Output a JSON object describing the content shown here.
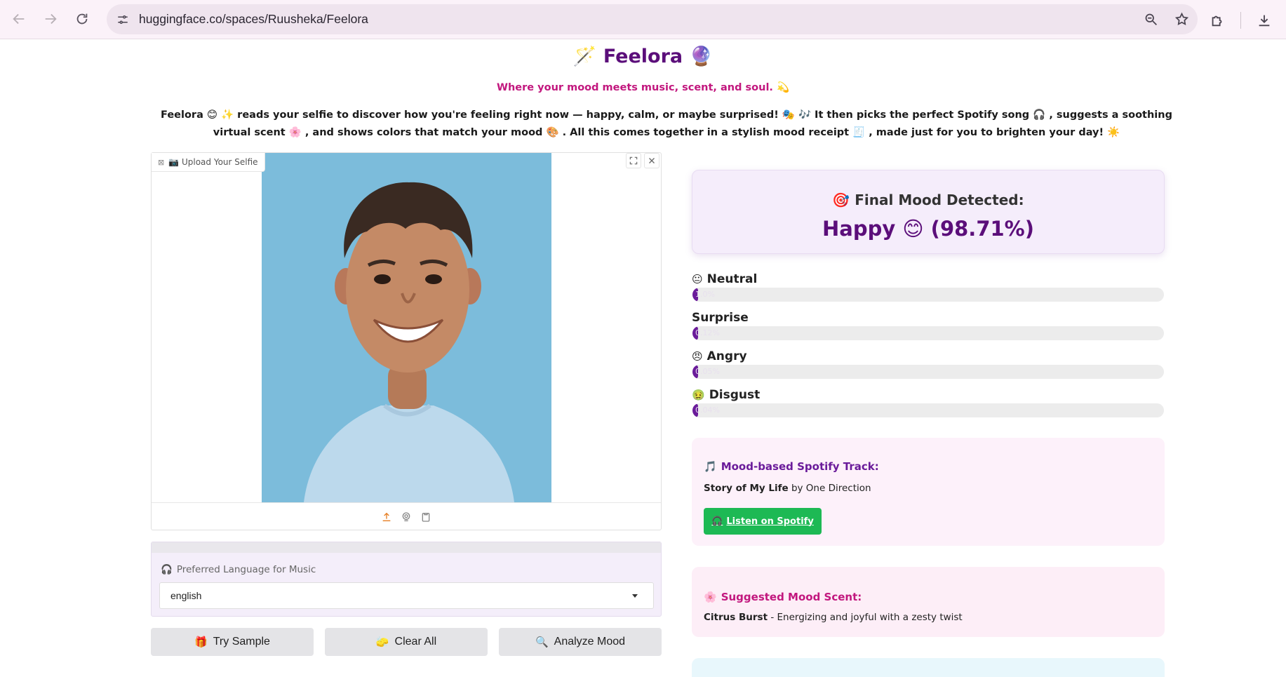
{
  "browser": {
    "url": "huggingface.co/spaces/Ruusheka/Feelora"
  },
  "header": {
    "title": "🪄 Feelora 🔮",
    "tagline": "Where your mood meets music, scent, and soul. 💫",
    "description": "Feelora 😊 ✨ reads your selfie to discover how you're feeling right now — happy, calm, or maybe surprised! 🎭 🎶 It then picks the perfect Spotify song 🎧 , suggests a soothing virtual scent 🌸 , and shows colors that match your mood 🎨 . All this comes together in a stylish mood receipt 🧾 , made just for you to brighten your day! ☀️"
  },
  "image_input": {
    "label": "📷 Upload Your Selfie",
    "label_icon": "image-icon"
  },
  "language": {
    "label": "Preferred Language for Music",
    "label_icon": "🎧",
    "value": "english"
  },
  "buttons": {
    "try_sample": {
      "icon": "🎁",
      "label": "Try Sample"
    },
    "clear_all": {
      "icon": "🧽",
      "label": "Clear All"
    },
    "analyze": {
      "icon": "🔍",
      "label": "Analyze Mood"
    }
  },
  "result": {
    "heading_icon": "🎯",
    "heading": "Final Mood Detected:",
    "mood": "Happy 😊 (98.71%)"
  },
  "emotions": [
    {
      "icon": "😐",
      "name": "Neutral",
      "pct": "1.0%",
      "value": 1.0
    },
    {
      "icon": "",
      "name": "Surprise",
      "pct": "0.12%",
      "value": 0.12
    },
    {
      "icon": "😠",
      "name": "Angry",
      "pct": "0.05%",
      "value": 0.05
    },
    {
      "icon": "🤢",
      "name": "Disgust",
      "pct": "0.04%",
      "value": 0.04
    }
  ],
  "spotify": {
    "icon": "🎵",
    "title": "Mood-based Spotify Track:",
    "track": "Story of My Life",
    "by": "by One Direction",
    "button_icon": "🎧",
    "button": "Listen on Spotify"
  },
  "scent": {
    "icon": "🌸",
    "title": "Suggested Mood Scent:",
    "name": "Citrus Burst",
    "desc": " - Energizing and joyful with a zesty twist"
  }
}
